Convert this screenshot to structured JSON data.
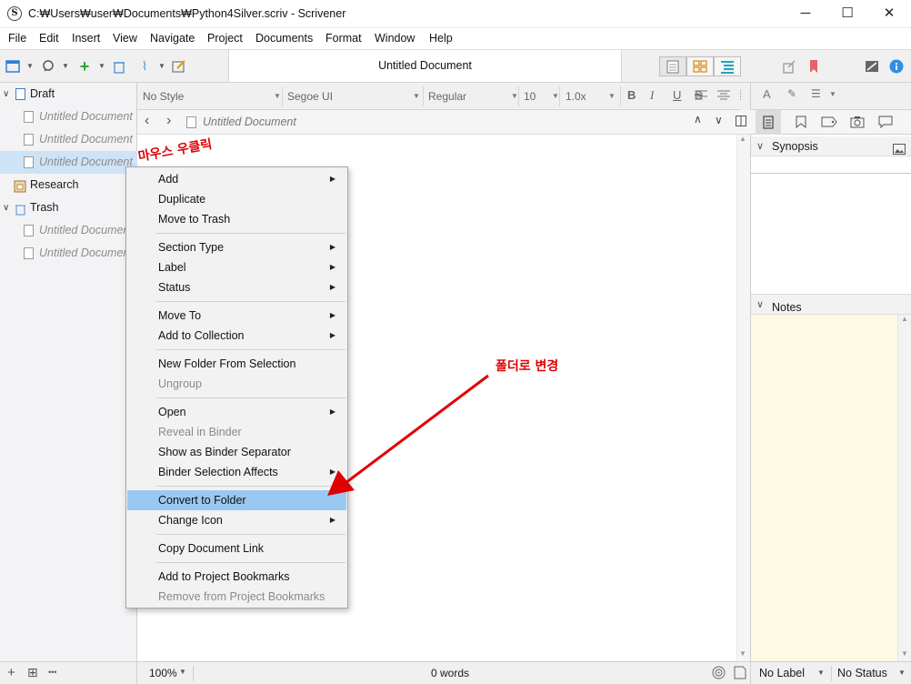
{
  "window": {
    "title": "C:₩Users₩user₩Documents₩Python4Silver.scriv - Scrivener",
    "app_icon": "S",
    "minimize": "─",
    "maximize": "☐",
    "close": "✕"
  },
  "menu": [
    "File",
    "Edit",
    "Insert",
    "View",
    "Navigate",
    "Project",
    "Documents",
    "Format",
    "Window",
    "Help"
  ],
  "toolbar": {
    "document_title": "Untitled Document"
  },
  "binder": {
    "items": [
      {
        "label": "Draft",
        "type": "folder"
      },
      {
        "label": "Untitled Document",
        "type": "doc"
      },
      {
        "label": "Untitled Document",
        "type": "doc"
      },
      {
        "label": "Untitled Document",
        "type": "doc",
        "selected": true
      },
      {
        "label": "Research",
        "type": "research"
      },
      {
        "label": "Trash",
        "type": "trash"
      },
      {
        "label": "Untitled Document",
        "type": "doc"
      },
      {
        "label": "Untitled Document",
        "type": "doc"
      }
    ],
    "footer": {
      "add": "+",
      "add_folder": "⊞",
      "more": "•••"
    }
  },
  "format_bar": {
    "style": "No Style",
    "font": "Segoe UI",
    "weight": "Regular",
    "size": "10",
    "line_spacing": "1.0x",
    "bold": "B",
    "italic": "I",
    "underline": "U",
    "strike": "S"
  },
  "header_bar": {
    "back": "‹",
    "forward": "›",
    "doc_title": "Untitled Document"
  },
  "footer": {
    "zoom": "100%",
    "word_count": "0 words"
  },
  "inspector": {
    "synopsis_label": "Synopsis",
    "notes_label": "Notes",
    "label_select": "No Label",
    "status_select": "No Status"
  },
  "context_menu": {
    "groups": [
      [
        {
          "label": "Add",
          "sub": true
        },
        {
          "label": "Duplicate"
        },
        {
          "label": "Move to Trash"
        }
      ],
      [
        {
          "label": "Section Type",
          "sub": true
        },
        {
          "label": "Label",
          "sub": true
        },
        {
          "label": "Status",
          "sub": true
        }
      ],
      [
        {
          "label": "Move To",
          "sub": true
        },
        {
          "label": "Add to Collection",
          "sub": true
        }
      ],
      [
        {
          "label": "New Folder From Selection"
        },
        {
          "label": "Ungroup",
          "disabled": true
        }
      ],
      [
        {
          "label": "Open",
          "sub": true
        },
        {
          "label": "Reveal in Binder",
          "disabled": true
        },
        {
          "label": "Show as Binder Separator"
        },
        {
          "label": "Binder Selection Affects",
          "sub": true
        }
      ],
      [
        {
          "label": "Convert to Folder",
          "highlighted": true
        },
        {
          "label": "Change Icon",
          "sub": true
        }
      ],
      [
        {
          "label": "Copy Document Link"
        }
      ],
      [
        {
          "label": "Add to Project Bookmarks"
        },
        {
          "label": "Remove from Project Bookmarks",
          "disabled": true
        }
      ]
    ]
  },
  "annotations": {
    "right_click": "마우스 우클릭",
    "convert": "폴더로 변경"
  },
  "colors": {
    "highlight": "#99c9f2",
    "annotation": "#e00000",
    "notes_bg": "#fdf9e3",
    "binder_selection": "#cfe3f7"
  }
}
